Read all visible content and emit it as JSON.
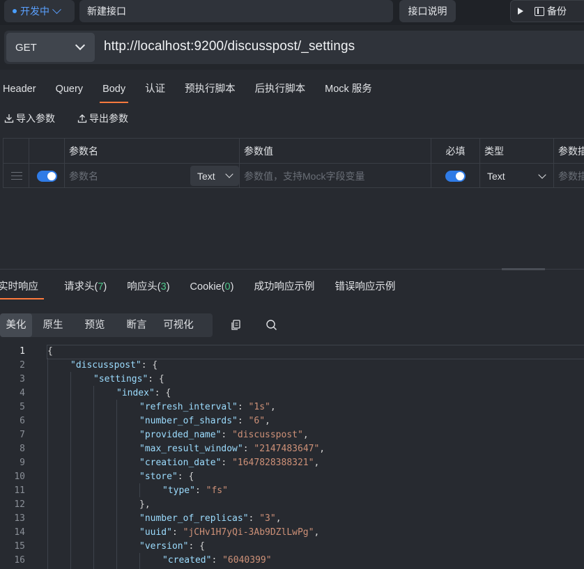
{
  "topbar": {
    "env_label": "开发中",
    "api_name": "新建接口",
    "doc_button": "接口说明",
    "backup_button": "备份"
  },
  "request": {
    "method": "GET",
    "url": "http://localhost:9200/discusspost/_settings"
  },
  "request_tabs": [
    "Header",
    "Query",
    "Body",
    "认证",
    "预执行脚本",
    "后执行脚本",
    "Mock 服务"
  ],
  "request_active_tab": "Body",
  "io": {
    "import_label": "导入参数",
    "export_label": "导出参数"
  },
  "param_table": {
    "headers": {
      "name": "参数名",
      "value": "参数值",
      "required": "必填",
      "type": "类型",
      "desc": "参数描"
    },
    "row": {
      "name_placeholder": "参数名",
      "name_type": "Text",
      "value_placeholder": "参数值，支持Mock字段变量",
      "type": "Text",
      "desc_placeholder": "参数描"
    }
  },
  "response_tabs": [
    {
      "label": "实时响应",
      "count": ""
    },
    {
      "label": "请求头",
      "count": "7"
    },
    {
      "label": "响应头",
      "count": "3"
    },
    {
      "label": "Cookie",
      "count": "0"
    },
    {
      "label": "成功响应示例",
      "count": ""
    },
    {
      "label": "错误响应示例",
      "count": ""
    }
  ],
  "format_tabs": [
    "美化",
    "原生",
    "预览",
    "断言",
    "可视化"
  ],
  "format_active": "美化",
  "code_lines": [
    {
      "n": "1",
      "indent": 0,
      "parts": [
        [
          "p",
          "{"
        ]
      ]
    },
    {
      "n": "2",
      "indent": 1,
      "parts": [
        [
          "k",
          "\"discusspost\""
        ],
        [
          "p",
          ": {"
        ]
      ]
    },
    {
      "n": "3",
      "indent": 2,
      "parts": [
        [
          "k",
          "\"settings\""
        ],
        [
          "p",
          ": {"
        ]
      ]
    },
    {
      "n": "4",
      "indent": 3,
      "parts": [
        [
          "k",
          "\"index\""
        ],
        [
          "p",
          ": {"
        ]
      ]
    },
    {
      "n": "5",
      "indent": 4,
      "parts": [
        [
          "k",
          "\"refresh_interval\""
        ],
        [
          "p",
          ": "
        ],
        [
          "s",
          "\"1s\""
        ],
        [
          "p",
          ","
        ]
      ]
    },
    {
      "n": "6",
      "indent": 4,
      "parts": [
        [
          "k",
          "\"number_of_shards\""
        ],
        [
          "p",
          ": "
        ],
        [
          "s",
          "\"6\""
        ],
        [
          "p",
          ","
        ]
      ]
    },
    {
      "n": "7",
      "indent": 4,
      "parts": [
        [
          "k",
          "\"provided_name\""
        ],
        [
          "p",
          ": "
        ],
        [
          "s",
          "\"discusspost\""
        ],
        [
          "p",
          ","
        ]
      ]
    },
    {
      "n": "8",
      "indent": 4,
      "parts": [
        [
          "k",
          "\"max_result_window\""
        ],
        [
          "p",
          ": "
        ],
        [
          "s",
          "\"2147483647\""
        ],
        [
          "p",
          ","
        ]
      ]
    },
    {
      "n": "9",
      "indent": 4,
      "parts": [
        [
          "k",
          "\"creation_date\""
        ],
        [
          "p",
          ": "
        ],
        [
          "s",
          "\"1647828388321\""
        ],
        [
          "p",
          ","
        ]
      ]
    },
    {
      "n": "10",
      "indent": 4,
      "parts": [
        [
          "k",
          "\"store\""
        ],
        [
          "p",
          ": {"
        ]
      ]
    },
    {
      "n": "11",
      "indent": 5,
      "parts": [
        [
          "k",
          "\"type\""
        ],
        [
          "p",
          ": "
        ],
        [
          "s",
          "\"fs\""
        ]
      ]
    },
    {
      "n": "12",
      "indent": 4,
      "parts": [
        [
          "p",
          "},"
        ]
      ]
    },
    {
      "n": "13",
      "indent": 4,
      "parts": [
        [
          "k",
          "\"number_of_replicas\""
        ],
        [
          "p",
          ": "
        ],
        [
          "s",
          "\"3\""
        ],
        [
          "p",
          ","
        ]
      ]
    },
    {
      "n": "14",
      "indent": 4,
      "parts": [
        [
          "k",
          "\"uuid\""
        ],
        [
          "p",
          ": "
        ],
        [
          "s",
          "\"jCHv1H7yQi-3Ab9DZlLwPg\""
        ],
        [
          "p",
          ","
        ]
      ]
    },
    {
      "n": "15",
      "indent": 4,
      "parts": [
        [
          "k",
          "\"version\""
        ],
        [
          "p",
          ": {"
        ]
      ]
    },
    {
      "n": "16",
      "indent": 5,
      "parts": [
        [
          "k",
          "\"created\""
        ],
        [
          "p",
          ": "
        ],
        [
          "s",
          "\"6040399\""
        ]
      ]
    }
  ],
  "colors": {
    "accent": "#ff7a3d",
    "toggle": "#2f7be6",
    "env": "#5aa0ff",
    "count": "#4ec58a"
  }
}
